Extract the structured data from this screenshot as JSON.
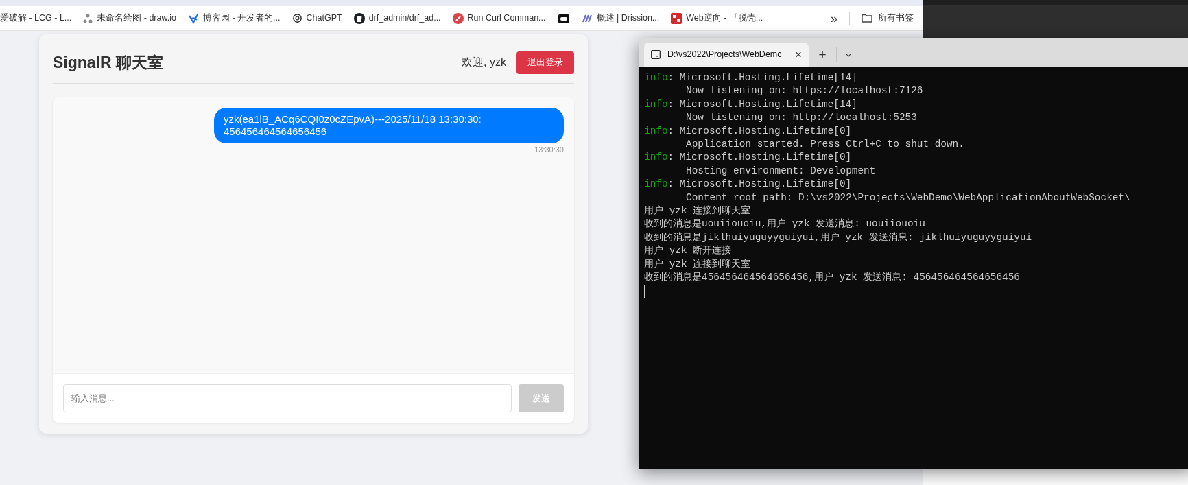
{
  "bookmarks": [
    {
      "kind": "link",
      "label": "爱破解 - LCG - L..."
    },
    {
      "kind": "link",
      "label": "未命名绘图 - draw.io"
    },
    {
      "kind": "link",
      "label": "博客园 - 开发者的..."
    },
    {
      "kind": "link",
      "label": "ChatGPT"
    },
    {
      "kind": "link",
      "label": "drf_admin/drf_ad..."
    },
    {
      "kind": "link",
      "label": "Run Curl Comman..."
    },
    {
      "kind": "icon_only"
    },
    {
      "kind": "link",
      "label": "概述 | Drission..."
    },
    {
      "kind": "link",
      "label": "Web逆向 - 『脱壳..."
    }
  ],
  "bookmarks_more": "»",
  "all_bookmarks": "所有书签",
  "chat": {
    "title": "SignalR 聊天室",
    "welcome": "欢迎, yzk",
    "logout": "退出登录",
    "messages": [
      {
        "text": "yzk(ea1lB_ACq6CQI0z0cZEpvA)---2025/11/18 13:30:30: 456456464564656456",
        "time": "13:30:30",
        "mine": true
      }
    ],
    "input": {
      "placeholder": "输入消息..."
    },
    "send": {
      "label": "发送",
      "disabled": true
    }
  },
  "terminal": {
    "tab": "D:\\vs2022\\Projects\\WebDemc",
    "close": "×",
    "new_tab": "+",
    "lines": [
      {
        "kind": "log",
        "tag": "info",
        "text": ": Microsoft.Hosting.Lifetime[14]"
      },
      {
        "kind": "detail",
        "text": "Now listening on: https://localhost:7126"
      },
      {
        "kind": "log",
        "tag": "info",
        "text": ": Microsoft.Hosting.Lifetime[14]"
      },
      {
        "kind": "detail",
        "text": "Now listening on: http://localhost:5253"
      },
      {
        "kind": "log",
        "tag": "info",
        "text": ": Microsoft.Hosting.Lifetime[0]"
      },
      {
        "kind": "detail",
        "text": "Application started. Press Ctrl+C to shut down."
      },
      {
        "kind": "log",
        "tag": "info",
        "text": ": Microsoft.Hosting.Lifetime[0]"
      },
      {
        "kind": "detail",
        "text": "Hosting environment: Development"
      },
      {
        "kind": "log",
        "tag": "info",
        "text": ": Microsoft.Hosting.Lifetime[0]"
      },
      {
        "kind": "detail",
        "text": "Content root path: D:\\vs2022\\Projects\\WebDemo\\WebApplicationAboutWebSocket\\"
      },
      {
        "kind": "plain",
        "text": "用户 yzk 连接到聊天室"
      },
      {
        "kind": "plain",
        "text": "收到的消息是uouiiouoiu,用户 yzk 发送消息: uouiiouoiu"
      },
      {
        "kind": "plain",
        "text": "收到的消息是jiklhuiyuguyyguiyui,用户 yzk 发送消息: jiklhuiyuguyyguiyui"
      },
      {
        "kind": "plain",
        "text": "用户 yzk 断开连接"
      },
      {
        "kind": "plain",
        "text": "用户 yzk 连接到聊天室"
      },
      {
        "kind": "plain",
        "text": "收到的消息是456456464564656456,用户 yzk 发送消息: 456456464564656456"
      }
    ]
  }
}
